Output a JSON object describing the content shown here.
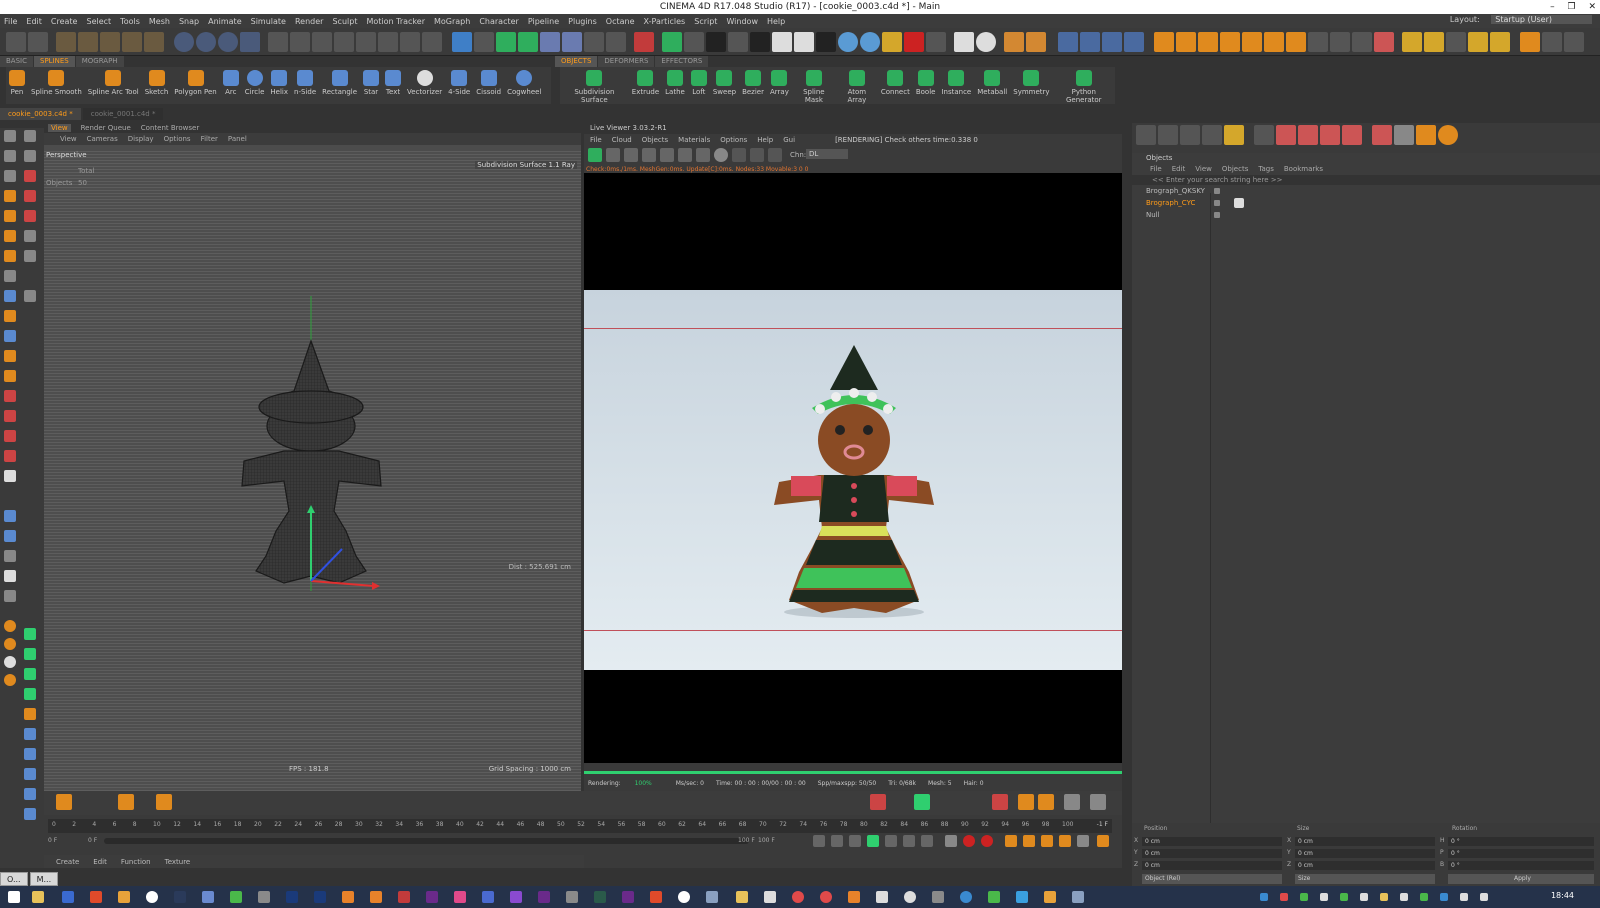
{
  "window": {
    "title": "CINEMA 4D R17.048 Studio (R17) - [cookie_0003.c4d *] - Main",
    "min": "–",
    "max": "❐",
    "close": "✕"
  },
  "menubar": {
    "items": [
      "File",
      "Edit",
      "Create",
      "Select",
      "Tools",
      "Mesh",
      "Snap",
      "Animate",
      "Simulate",
      "Render",
      "Sculpt",
      "Motion Tracker",
      "MoGraph",
      "Character",
      "Pipeline",
      "Plugins",
      "Octane",
      "X-Particles",
      "Script",
      "Window",
      "Help"
    ],
    "layout_label": "Layout:",
    "layout_value": "Startup (User)"
  },
  "palette_tabs_left": [
    "BASIC",
    "SPLINES",
    "MOGRAPH"
  ],
  "palette_tabs_right": [
    "OBJECTS",
    "DEFORMERS",
    "EFFECTORS"
  ],
  "spline_tools": [
    "Pen",
    "Spline Smooth",
    "Spline Arc Tool",
    "Sketch",
    "Polygon Pen",
    "Arc",
    "Circle",
    "Helix",
    "n-Side",
    "Rectangle",
    "Star",
    "Text",
    "Vectorizer",
    "4-Side",
    "Cissoid",
    "Cogwheel"
  ],
  "object_tools": [
    "Subdivision Surface",
    "Extrude",
    "Lathe",
    "Loft",
    "Sweep",
    "Bezier",
    "Array",
    "Spline Mask",
    "Atom Array",
    "Connect",
    "Boole",
    "Instance",
    "Metaball",
    "Symmetry",
    "Python Generator"
  ],
  "doc_tabs": [
    "cookie_0003.c4d *",
    "cookie_0001.c4d *"
  ],
  "viewport": {
    "tabs": [
      "View",
      "Render Queue",
      "Content Browser"
    ],
    "menu": [
      "View",
      "Cameras",
      "Display",
      "Options",
      "Filter",
      "Panel"
    ],
    "camera": "Perspective",
    "total_label": "Total",
    "objects_label": "Objects",
    "objects_count": "50",
    "subdivision_label": "Subdivision Surface 1.1 Ray",
    "fps": "FPS : 181.8",
    "grid_spacing": "Grid Spacing : 1000 cm",
    "dist": "Dist : 525.691 cm"
  },
  "liveviewer": {
    "title": "Live Viewer 3.03.2-R1",
    "menu": [
      "File",
      "Cloud",
      "Objects",
      "Materials",
      "Options",
      "Help",
      "Gui"
    ],
    "render_status": "[RENDERING] Check others time:0.338  0",
    "channel_label": "Chn:",
    "channel_value": "DL",
    "check_line": "Check:0ms./1ms. MeshGen:0ms. Update[C]:0ms. Nodes:33 Movable:3  0  0",
    "footer": {
      "rendering_label": "Rendering:",
      "rendering_value": "100%",
      "mssec": "Ms/sec: 0",
      "time": "Time: 00 : 00 : 00/00 : 00 : 00",
      "spp": "Spp/maxspp: 50/50",
      "tri": "Tri: 0/68k",
      "mesh": "Mesh: 5",
      "hair": "Hair: 0"
    },
    "render_progress": 1.0
  },
  "objects_panel": {
    "title": "Objects",
    "menu": [
      "File",
      "Edit",
      "View",
      "Objects",
      "Tags",
      "Bookmarks"
    ],
    "search_placeholder": "<< Enter your search string here >>",
    "rows": [
      "Brograph_QKSKY",
      "Brograph_CYC",
      "Null"
    ],
    "selected_index": 1
  },
  "timeline": {
    "ticks": [
      "0",
      "2",
      "4",
      "6",
      "8",
      "10",
      "12",
      "14",
      "16",
      "18",
      "20",
      "22",
      "24",
      "26",
      "28",
      "30",
      "32",
      "34",
      "36",
      "38",
      "40",
      "42",
      "44",
      "46",
      "48",
      "50",
      "52",
      "54",
      "56",
      "58",
      "60",
      "62",
      "64",
      "66",
      "68",
      "70",
      "72",
      "74",
      "76",
      "78",
      "80",
      "82",
      "84",
      "86",
      "88",
      "90",
      "92",
      "94",
      "96",
      "98",
      "100"
    ],
    "current_frame": "-1 F",
    "start": "0 F",
    "start2": "0 F",
    "end_mid": "100 F",
    "end": "100 F"
  },
  "coords": {
    "position": "Position",
    "size": "Size",
    "rotation": "Rotation",
    "rows": [
      {
        "axis": "X",
        "pos": "0 cm",
        "size_axis": "X",
        "size": "0 cm",
        "rot_axis": "H",
        "rot": "0 °"
      },
      {
        "axis": "Y",
        "pos": "0 cm",
        "size_axis": "Y",
        "size": "0 cm",
        "rot_axis": "P",
        "rot": "0 °"
      },
      {
        "axis": "Z",
        "pos": "0 cm",
        "size_axis": "Z",
        "size": "0 cm",
        "rot_axis": "B",
        "rot": "0 °"
      }
    ],
    "mode": "Object (Rel)",
    "size_mode": "Size",
    "apply": "Apply"
  },
  "material_menu": [
    "Create",
    "Edit",
    "Function",
    "Texture"
  ],
  "task_windows": [
    "O...",
    "M..."
  ],
  "clock": "18:44",
  "colors": {
    "accent": "#ff9c1a",
    "green": "#2fcf6f",
    "octane": "#2a9b4a"
  }
}
